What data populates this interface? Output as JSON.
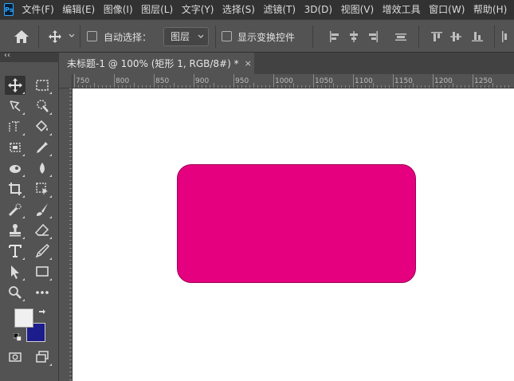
{
  "app": {
    "logo": "Ps"
  },
  "menu": [
    "文件(F)",
    "编辑(E)",
    "图像(I)",
    "图层(L)",
    "文字(Y)",
    "选择(S)",
    "滤镜(T)",
    "3D(D)",
    "视图(V)",
    "增效工具",
    "窗口(W)",
    "帮助(H)"
  ],
  "options": {
    "auto_select_label": "自动选择：",
    "auto_select_target": "图层",
    "show_transform_label": "显示变换控件"
  },
  "document": {
    "tab_title": "未标题-1 @ 100% (矩形 1, RGB/8#) *",
    "close_glyph": "×"
  },
  "toolbar": {
    "collapse_glyph": "‹‹"
  },
  "ruler": {
    "top_labels": [
      "750",
      "800",
      "850",
      "900",
      "950",
      "1000",
      "1050",
      "1100",
      "1150",
      "1200",
      "1250"
    ]
  },
  "colors": {
    "foreground": "#f0f0f0",
    "background": "#1c1c8c",
    "shape_fill": "#e4007e"
  },
  "icons": {
    "tools": [
      "move-icon",
      "marquee-icon",
      "lasso-icon",
      "quick-select-icon",
      "crop-icon",
      "frame-icon",
      "eyedropper-icon",
      "spot-heal-icon",
      "brush-icon",
      "stamp-icon",
      "eraser-icon",
      "bucket-icon",
      "blur-icon",
      "dodge-icon",
      "pen-icon",
      "type-icon",
      "path-select-icon",
      "rectangle-icon",
      "zoom-icon",
      "more-icon",
      "quick-mask-icon",
      "screen-mode-icon"
    ]
  }
}
